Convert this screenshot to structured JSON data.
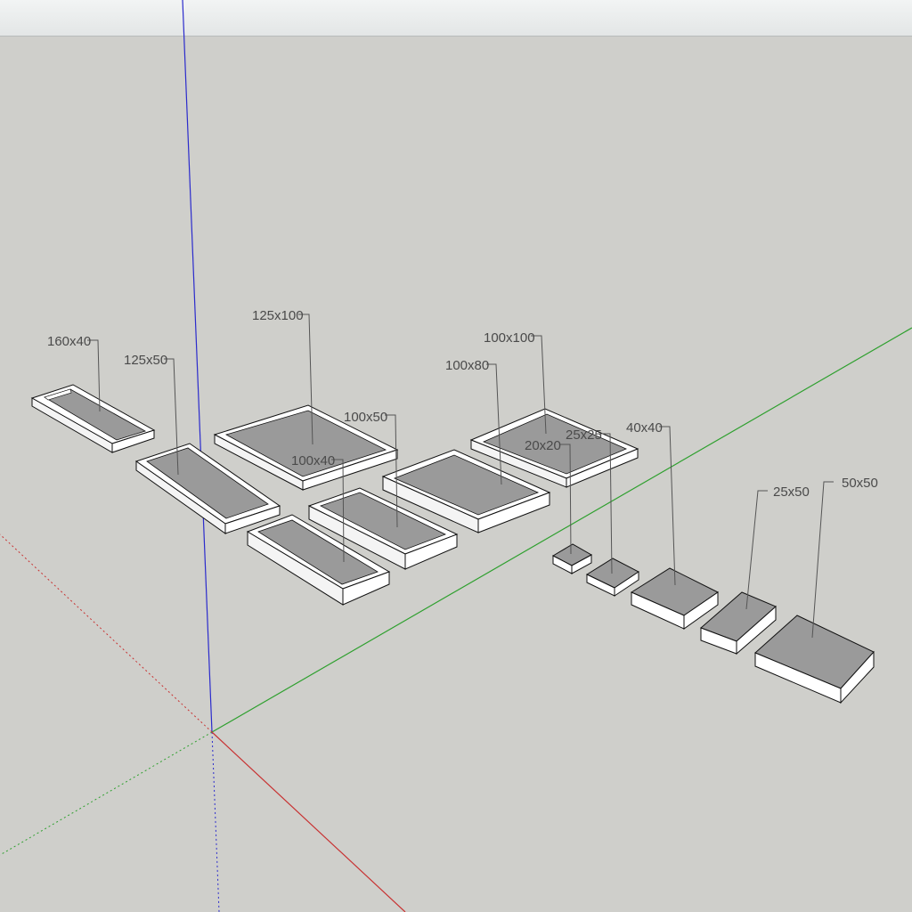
{
  "colors": {
    "background": "#cfcfcb",
    "toolbar": "#eceeee",
    "blue_axis": "#2b2bcc",
    "green_axis": "#2fa02f",
    "red_axis": "#c83232",
    "base_top": "#9a9a9a",
    "base_rim": "#ffffff",
    "edge": "#111111",
    "leader": "#555555"
  },
  "scene": {
    "bases": [
      {
        "label": "160x40"
      },
      {
        "label": "125x50"
      },
      {
        "label": "125x100"
      },
      {
        "label": "100x40"
      },
      {
        "label": "100x50"
      },
      {
        "label": "100x80"
      },
      {
        "label": "100x100"
      },
      {
        "label": "20x20"
      },
      {
        "label": "25x25"
      },
      {
        "label": "40x40"
      },
      {
        "label": "25x50"
      },
      {
        "label": "50x50"
      }
    ]
  }
}
